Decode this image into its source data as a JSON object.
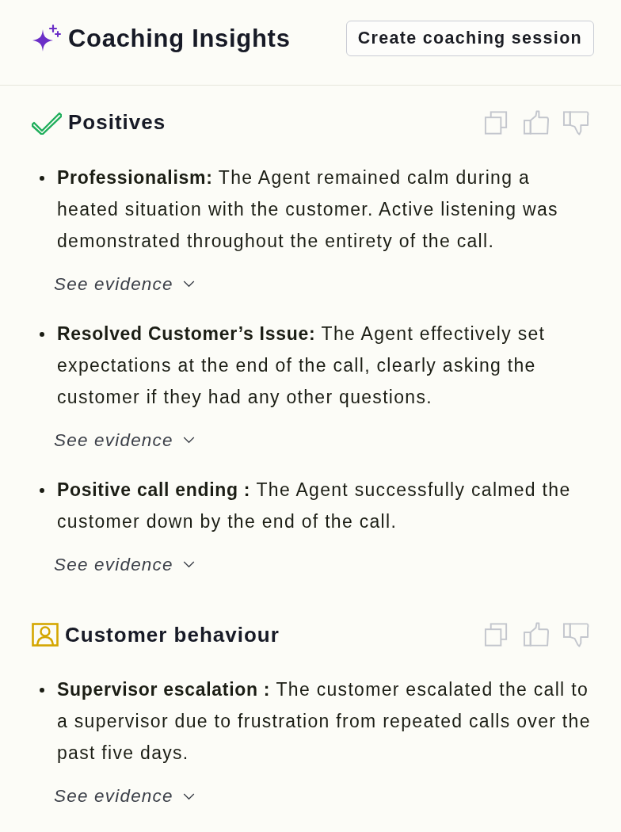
{
  "header": {
    "title": "Coaching Insights",
    "button": "Create coaching session"
  },
  "sections": [
    {
      "kind": "positive",
      "title": "Positives",
      "items": [
        {
          "label": "Professionalism:",
          "text": "The Agent remained calm during a heated situation with the customer. Active listening was demonstrated throughout the entirety of the call.",
          "evidence": {
            "label": "See evidence",
            "expanded": false
          }
        },
        {
          "label": "Resolved Customer’s Issue:",
          "text": "The Agent effectively set expectations at the end of the call, clearly asking the customer if they had any other questions.",
          "evidence": {
            "label": "See evidence",
            "expanded": false
          }
        },
        {
          "label": "Positive call ending :",
          "text": "The Agent successfully calmed the customer down by the end of the call.",
          "evidence": {
            "label": "See evidence",
            "expanded": false
          }
        }
      ]
    },
    {
      "kind": "customer",
      "title": "Customer behaviour",
      "items": [
        {
          "label": "Supervisor escalation :",
          "text": "The customer escalated the call to a supervisor due to frustration from repeated calls over the past five days.",
          "evidence": {
            "label": "See evidence",
            "expanded": false
          }
        }
      ]
    }
  ]
}
